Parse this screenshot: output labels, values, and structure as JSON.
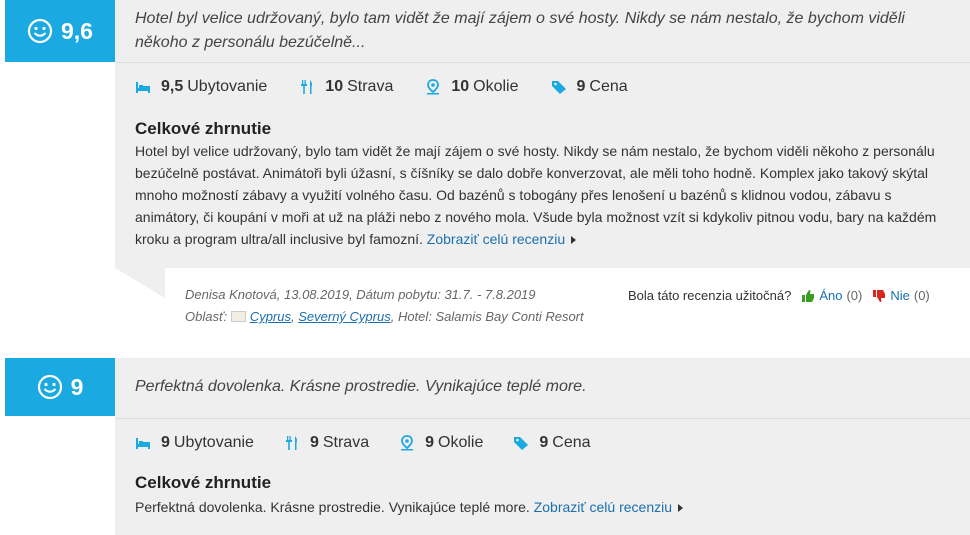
{
  "reviews": [
    {
      "score": "9,6",
      "headline": "Hotel byl velice udržovaný, bylo tam vidět že mají zájem o své hosty. Nikdy se nám nestalo, že bychom viděli někoho z personálu bezúčelně...",
      "ratings": [
        {
          "value": "9,5",
          "label": "Ubytovanie",
          "icon": "bed-icon"
        },
        {
          "value": "10",
          "label": "Strava",
          "icon": "cutlery-icon"
        },
        {
          "value": "10",
          "label": "Okolie",
          "icon": "location-icon"
        },
        {
          "value": "9",
          "label": "Cena",
          "icon": "price-tag-icon"
        }
      ],
      "summary_title": "Celkové zhrnutie",
      "summary_text": "Hotel byl velice udržovaný, bylo tam vidět že mají zájem o své hosty. Nikdy se nám nestalo, že bychom viděli někoho z personálu bezúčelně postávat. Animátoři byli úžasní, s číšníky se dalo dobře konverzovat, ale měli toho hodně. Komplex jako takový skýtal mnoho možností zábavy a využití volného času. Od bazénů s tobogány přes lenošení u bazénů s klidnou vodou, zábavu s animátory, či koupání v moři at už na pláži nebo z nového mola. Všude byla možnost vzít si kdykoliv pitnou vodu, bary na každém kroku a program ultra/all inclusive byl famozní.",
      "more_link": "Zobraziť celú recenziu",
      "author_line": "Denisa Knotová, 13.08.2019, Dátum pobytu: 31.7. - 7.8.2019",
      "area_label": "Oblasť:",
      "area_country": "Cyprus",
      "area_region": "Severný Cyprus",
      "hotel_text": ", Hotel: Salamis Bay Conti Resort",
      "helpful_question": "Bola táto recenzia užitočná?",
      "yes_label": "Áno",
      "yes_count": "(0)",
      "no_label": "Nie",
      "no_count": "(0)"
    },
    {
      "score": "9",
      "headline": "Perfektná dovolenka. Krásne prostredie. Vynikajúce teplé more.",
      "ratings": [
        {
          "value": "9",
          "label": "Ubytovanie",
          "icon": "bed-icon"
        },
        {
          "value": "9",
          "label": "Strava",
          "icon": "cutlery-icon"
        },
        {
          "value": "9",
          "label": "Okolie",
          "icon": "location-icon"
        },
        {
          "value": "9",
          "label": "Cena",
          "icon": "price-tag-icon"
        }
      ],
      "summary_title": "Celkové zhrnutie",
      "summary_text": "Perfektná dovolenka. Krásne prostredie. Vynikajúce teplé more.",
      "more_link": "Zobraziť celú recenziu"
    }
  ],
  "colors": {
    "accent": "#1ba9e1",
    "panel": "#efefef",
    "link": "#1a6fb0",
    "thumb_up": "#3a9d23",
    "thumb_down": "#d9261c"
  }
}
